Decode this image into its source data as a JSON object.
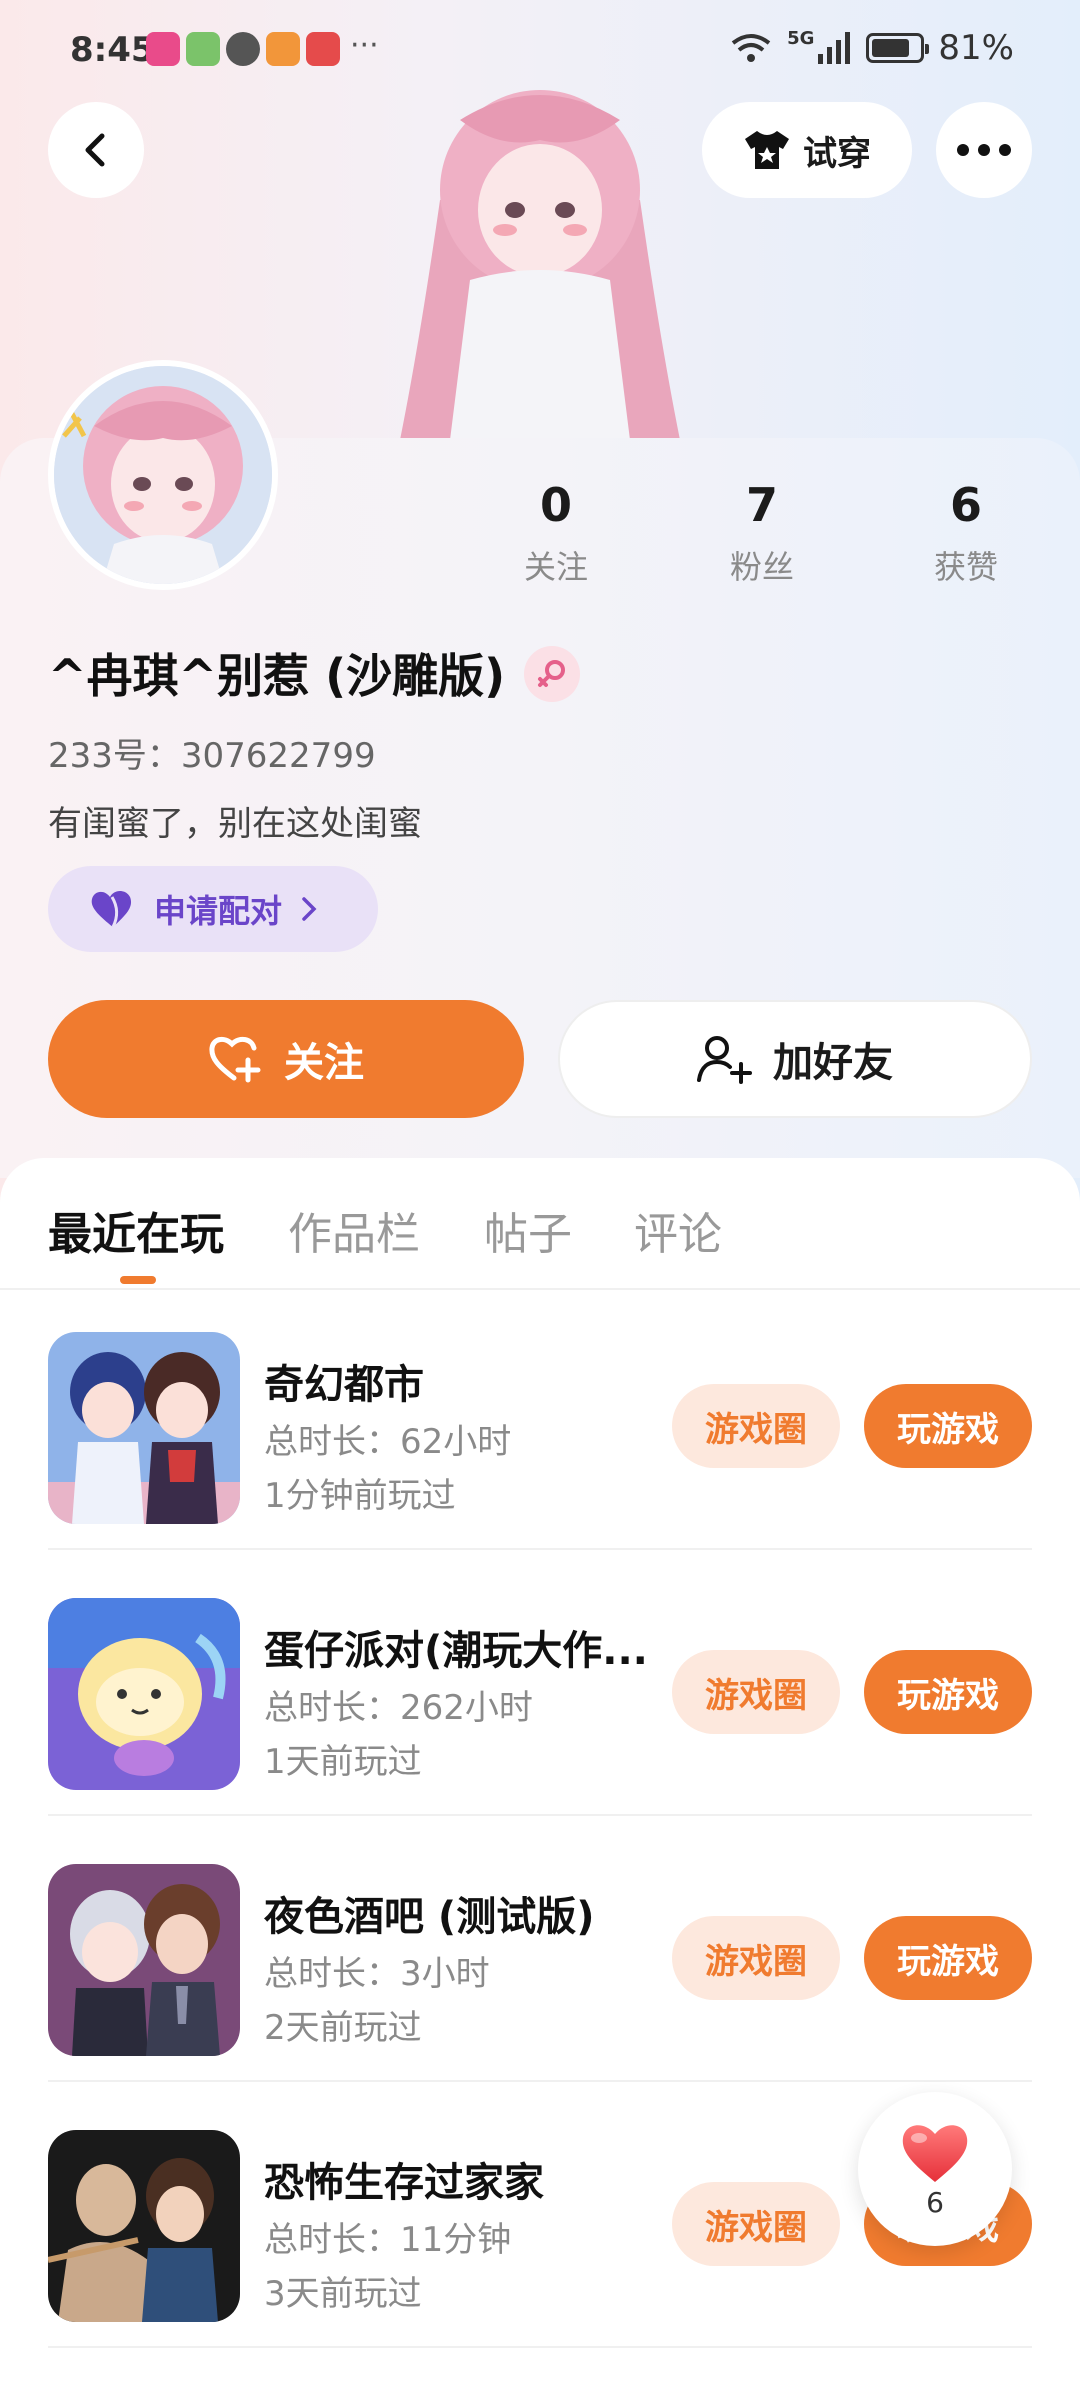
{
  "status_bar": {
    "time": "8:45",
    "more": "···",
    "battery_percent": "81%",
    "battery_level": 0.81,
    "signal_label": "5G"
  },
  "header": {
    "try_on_label": "试穿"
  },
  "profile": {
    "stats": [
      {
        "value": "0",
        "label": "关注"
      },
      {
        "value": "7",
        "label": "粉丝"
      },
      {
        "value": "6",
        "label": "获赞"
      }
    ],
    "name": "^冉琪^别惹 (沙雕版)",
    "uid": "233号：307622799",
    "bio": "有闺蜜了，别在这处闺蜜",
    "pair_label": "申请配对",
    "follow_label": "关注",
    "add_friend_label": "加好友"
  },
  "tabs": [
    {
      "label": "最近在玩",
      "active": true
    },
    {
      "label": "作品栏",
      "active": false
    },
    {
      "label": "帖子",
      "active": false
    },
    {
      "label": "评论",
      "active": false
    }
  ],
  "games": [
    {
      "title": "奇幻都市",
      "duration": "总时长：62小时",
      "last_played": "1分钟前玩过",
      "circle_label": "游戏圈",
      "play_label": "玩游戏"
    },
    {
      "title": "蛋仔派对(潮玩大作...",
      "duration": "总时长：262小时",
      "last_played": "1天前玩过",
      "circle_label": "游戏圈",
      "play_label": "玩游戏"
    },
    {
      "title": "夜色酒吧 (测试版)",
      "duration": "总时长：3小时",
      "last_played": "2天前玩过",
      "circle_label": "游戏圈",
      "play_label": "玩游戏"
    },
    {
      "title": "恐怖生存过家家",
      "duration": "总时长：11分钟",
      "last_played": "3天前玩过",
      "circle_label": "游戏圈",
      "play_label": "玩游戏"
    }
  ],
  "like_fab": {
    "count": "6"
  },
  "colors": {
    "accent": "#f07b2f",
    "accent_light": "#fde8dd",
    "pair_purple": "#6a45c9"
  }
}
